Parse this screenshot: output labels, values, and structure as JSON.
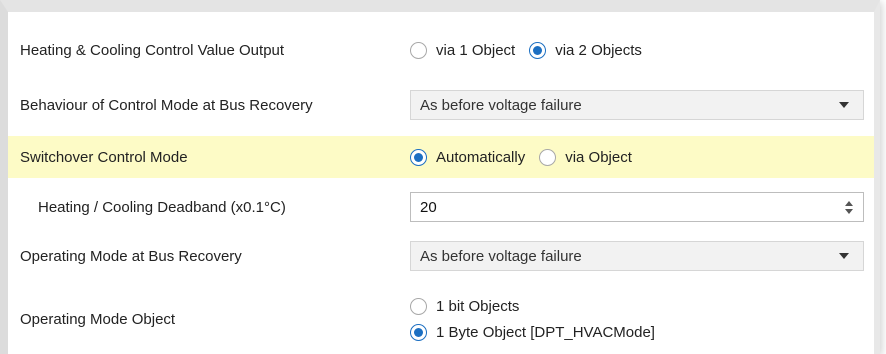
{
  "rows": {
    "output": {
      "label": "Heating & Cooling Control Value Output",
      "options": [
        "via 1 Object",
        "via 2 Objects"
      ],
      "selected": "via 2 Objects"
    },
    "behaviour": {
      "label": "Behaviour of Control Mode at Bus Recovery",
      "value": "As before voltage failure"
    },
    "switchover": {
      "label": "Switchover Control Mode",
      "options": [
        "Automatically",
        "via Object"
      ],
      "selected": "Automatically"
    },
    "deadband": {
      "label": "Heating / Cooling Deadband (x0.1°C)",
      "value": "20"
    },
    "operating_recovery": {
      "label": "Operating Mode at Bus Recovery",
      "value": "As before voltage failure"
    },
    "operating_object": {
      "label": "Operating Mode Object",
      "options": [
        "1 bit Objects",
        "1 Byte Object [DPT_HVACMode]"
      ],
      "selected": "1 Byte Object [DPT_HVACMode]"
    }
  },
  "colors": {
    "highlight": "#fdfbc6",
    "radio_accent": "#1c6fc2"
  }
}
